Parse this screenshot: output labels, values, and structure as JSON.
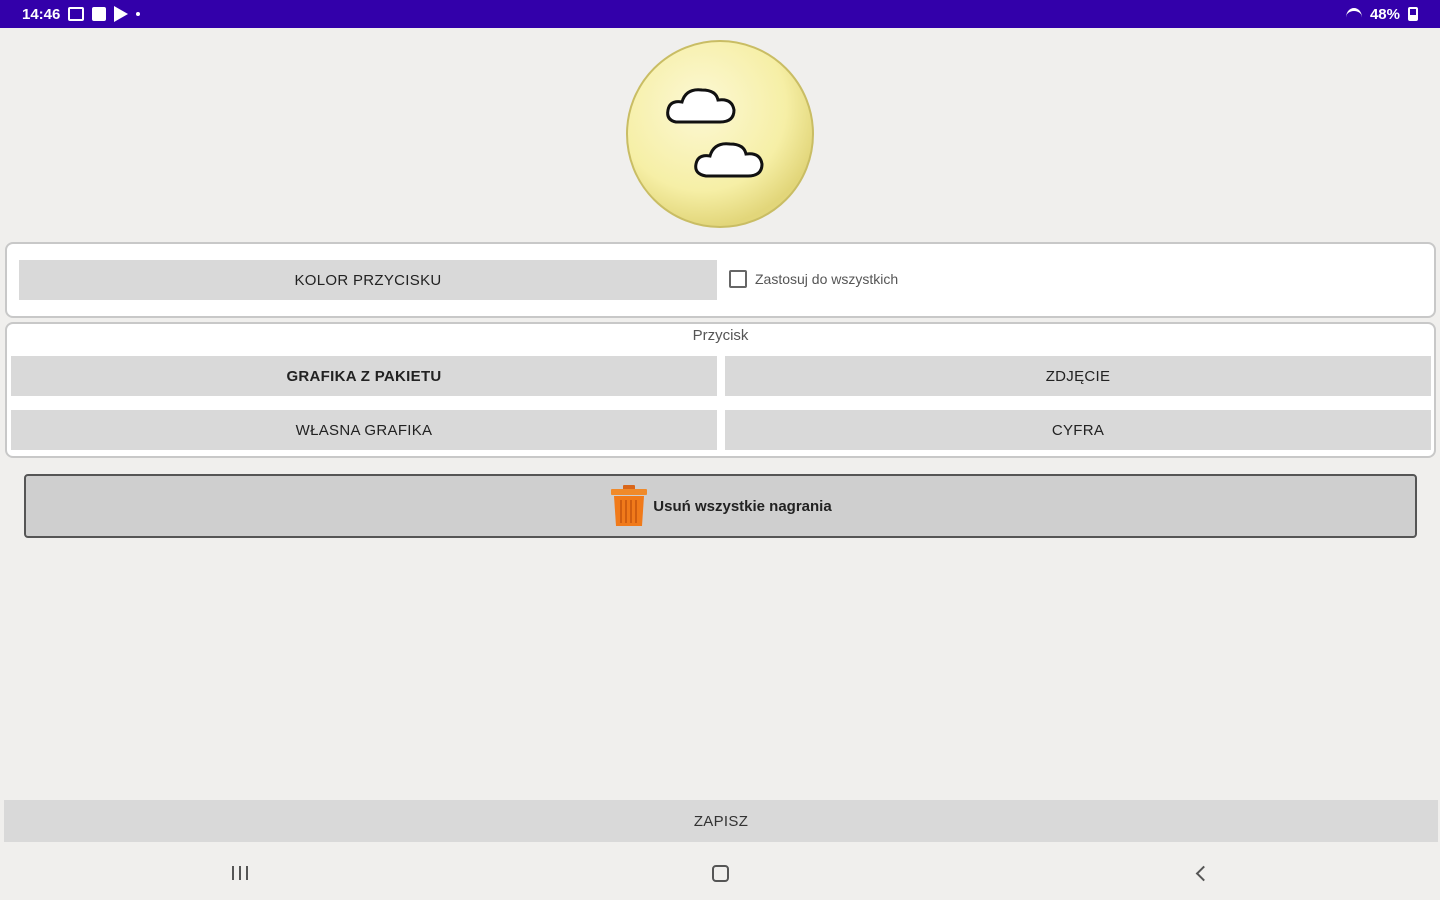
{
  "status_bar": {
    "time": "14:46",
    "battery": "48%"
  },
  "color_panel": {
    "button_label": "KOLOR PRZYCISKU",
    "apply_all_label": "Zastosuj do wszystkich",
    "apply_all_checked": false
  },
  "button_panel": {
    "title": "Przycisk",
    "graphic_from_package": "GRAFIKA Z PAKIETU",
    "photo": "ZDJĘCIE",
    "own_graphic": "WŁASNA GRAFIKA",
    "digit": "CYFRA"
  },
  "delete_all": {
    "label": "Usuń wszystkie nagrania",
    "icon": "trash-icon",
    "icon_color": "#f07a1a"
  },
  "save": {
    "label": "ZAPISZ"
  },
  "colors": {
    "status_bar": "#3300aa",
    "background": "#f0efed",
    "button_face": "#d9d9d9",
    "logo_yellow": "#f6efa6"
  }
}
